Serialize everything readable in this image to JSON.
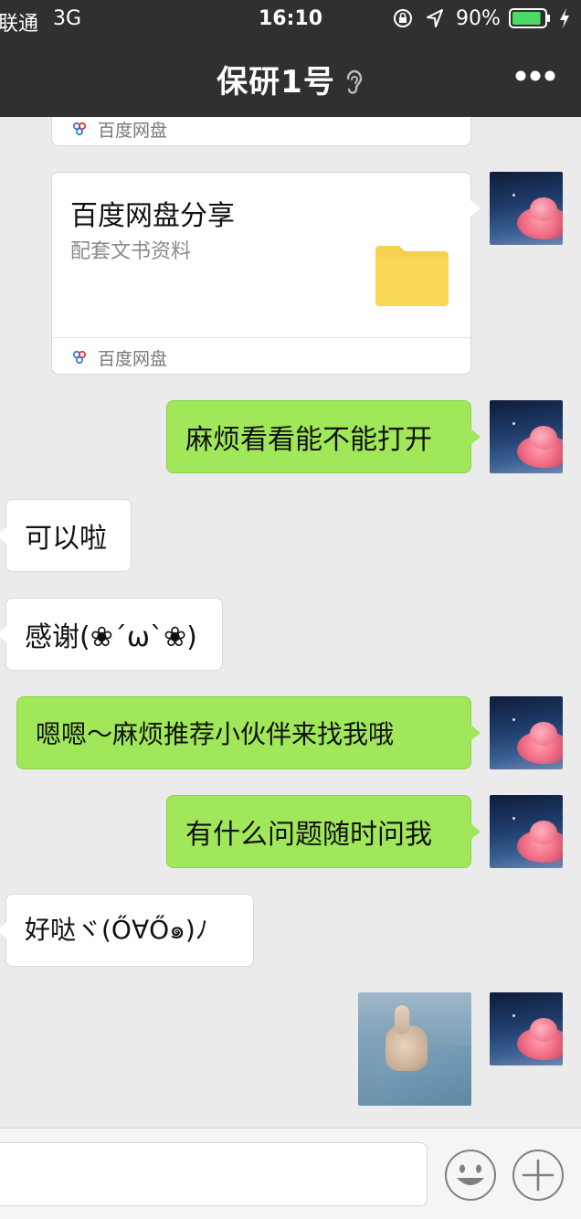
{
  "status_bar": {
    "carrier": "联通",
    "network": "3G",
    "time": "16:10",
    "battery_percent": "90%",
    "battery_level": 0.9,
    "icons": [
      "rotation-lock-icon",
      "location-arrow-icon",
      "battery-icon",
      "charging-bolt-icon"
    ]
  },
  "nav": {
    "title": "保研1号",
    "title_icon": "ear-icon",
    "more_icon": "more-dots-icon"
  },
  "messages": {
    "partial_card_source": "百度网盘",
    "card": {
      "title": "百度网盘分享",
      "description": "配套文书资料",
      "icon": "folder-icon",
      "source": "百度网盘"
    },
    "m1": "麻烦看看能不能打开",
    "m2": "可以啦",
    "m3": "感谢(❀ˊωˋ❀)",
    "m4": "嗯嗯～麻烦推荐小伙伴来找我哦",
    "m5": "有什么问题随时问我",
    "m6": "好哒ヾ(Ő∀Ő๑)ﾉ",
    "image_message": "thumbs-up-photo"
  },
  "input_bar": {
    "emoji_icon": "emoji-icon",
    "plus_icon": "plus-icon"
  },
  "colors": {
    "nav_bg": "#303030",
    "chat_bg": "#ebebeb",
    "outgoing_bubble": "#a0e75a",
    "incoming_bubble": "#ffffff",
    "folder": "#f6d04d"
  }
}
